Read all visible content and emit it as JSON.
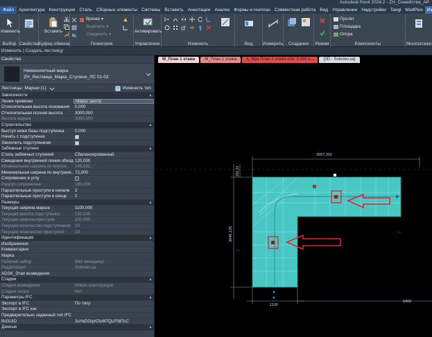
{
  "menu": {
    "items": [
      "Файл",
      "Архитектура",
      "Конструкция",
      "Сталь",
      "Сборные элементы",
      "Системы",
      "Вставить",
      "Аннотации",
      "Анализ",
      "Формы и генплан",
      "Совместная работа",
      "Вид",
      "Управление",
      "Надстройки",
      "Tangl",
      "ModPlus",
      "Из"
    ],
    "window_title": "Autodesk Revit 2024.2 - ZH_Семейства_АР"
  },
  "ribbon": {
    "modify": "Изменить",
    "select": "Выбор",
    "properties": "Свойства",
    "paste": "Вставить",
    "clipboard": "Буфер обмена",
    "cut": "Вырезать",
    "join": "Соединить",
    "cut_small": "Врезка",
    "geometry": "Геометрия",
    "activate": "Активировать",
    "manage": "Управление",
    "modify_group": "Изменить",
    "view": "Вид",
    "measure": "Измерить",
    "create": "Создание",
    "mode": "Режим",
    "run": "Пролет",
    "landing": "Площадка",
    "support": "Опора",
    "components": "Компоненты",
    "multistory": "Многоэтажн"
  },
  "options_bar": "Изменить | Создать лестницу",
  "view_tabs": [
    {
      "label": "М_План 1 этажа",
      "color": "#f2d6d6",
      "active": true
    },
    {
      "label": "М_План 1 этажа",
      "color": "#e98a8a",
      "active": false
    },
    {
      "label": "А_Мрк План 2 этажа отм. 3.000 в...",
      "color": "#e34b4b",
      "active": false
    },
    {
      "label": "{3D - Sobolev.sa}",
      "color": "#d9dee4",
      "active": false
    }
  ],
  "properties": {
    "header": "Свойства",
    "type_line1": "Немонолитный марш",
    "type_line2": "ZH_Лестница_Марш_Ступени_ЛС 01-03",
    "instance": "Лестницы: Марши (1)",
    "edit_type": "Изменить тип",
    "rows": [
      {
        "kind": "sec",
        "label": "Зависимости"
      },
      {
        "kind": "row",
        "label": "Линия привязки",
        "value": "Марш: центр",
        "input": true
      },
      {
        "kind": "row",
        "label": "Относительная высота основания",
        "value": "0,000"
      },
      {
        "kind": "row",
        "label": "Относительная полная высота",
        "value": "3000,000"
      },
      {
        "kind": "dim",
        "label": "Высота марша",
        "value": "3000,000"
      },
      {
        "kind": "sec",
        "label": "Строительство"
      },
      {
        "kind": "row",
        "label": "Выступ ниже базы подступенка",
        "value": "0,000"
      },
      {
        "kind": "chk",
        "label": "Начать с подступенка",
        "checked": true
      },
      {
        "kind": "chk",
        "label": "Закончить подступенком",
        "checked": true
      },
      {
        "kind": "sec",
        "label": "Забежные ступени"
      },
      {
        "kind": "row",
        "label": "Стиль забежных ступеней",
        "value": "Сбалансированный"
      },
      {
        "kind": "row",
        "label": "Смещение внутренней линии обхода",
        "value": "120,000"
      },
      {
        "kind": "dim",
        "label": "Минимальная ширина по внутре...",
        "value": "145,931"
      },
      {
        "kind": "row",
        "label": "Минимальная ширина по внутрене...",
        "value": "72,000"
      },
      {
        "kind": "chk",
        "label": "Сопряжение в углу",
        "checked": false
      },
      {
        "kind": "dim",
        "label": "Радиус сопряжения",
        "value": "180,000"
      },
      {
        "kind": "row",
        "label": "Параллельные проступи в начале",
        "value": "2"
      },
      {
        "kind": "row",
        "label": "Параллельные проступи в конце",
        "value": "2"
      },
      {
        "kind": "sec",
        "label": "Размеры"
      },
      {
        "kind": "row",
        "label": "Текущая ширина марша",
        "value": "1100,000"
      },
      {
        "kind": "dim",
        "label": "Текущая высота подступенка",
        "value": "150,000"
      },
      {
        "kind": "dim",
        "label": "Текущая ширина проступи",
        "value": "300,000"
      },
      {
        "kind": "dim",
        "label": "Текущее количество подступенков",
        "value": "20"
      },
      {
        "kind": "dim",
        "label": "Текущее количество проступей",
        "value": "19"
      },
      {
        "kind": "sec",
        "label": "Идентификация"
      },
      {
        "kind": "row",
        "label": "Изображение",
        "value": ""
      },
      {
        "kind": "row",
        "label": "Комментарии",
        "value": ""
      },
      {
        "kind": "row",
        "label": "Марка",
        "value": ""
      },
      {
        "kind": "dim",
        "label": "Рабочий набор",
        "value": "BIM менеджер"
      },
      {
        "kind": "dim",
        "label": "Редактирует",
        "value": "Sobolev.sa"
      },
      {
        "kind": "row",
        "label": "ADSK_Этап возведения",
        "value": ""
      },
      {
        "kind": "sec",
        "label": "Стадии"
      },
      {
        "kind": "dim",
        "label": "Стадия возведения",
        "value": "Новая конструкция"
      },
      {
        "kind": "dim",
        "label": "Стадия сноса",
        "value": "Нет"
      },
      {
        "kind": "sec",
        "label": "Параметры IFC"
      },
      {
        "kind": "row",
        "label": "Экспорт в IFC",
        "value": "По типу"
      },
      {
        "kind": "row",
        "label": "Экспорт в IFC как",
        "value": ""
      },
      {
        "kind": "row",
        "label": "Предварительно заданный тип IFC",
        "value": ""
      },
      {
        "kind": "row",
        "label": "IfcGUID",
        "value": "3uYeDGqvCfuM7QLP38TcC"
      },
      {
        "kind": "sec",
        "label": "Данные"
      }
    ]
  },
  "canvas": {
    "dim_top": "3997,302",
    "dim_left": "3048,126",
    "dim_left_small": "250,32",
    "dim_bottom_left": "1100",
    "dim_bottom_right": "6400",
    "stair_color": "#48c7c4",
    "arrow_color": "#e8202a"
  }
}
